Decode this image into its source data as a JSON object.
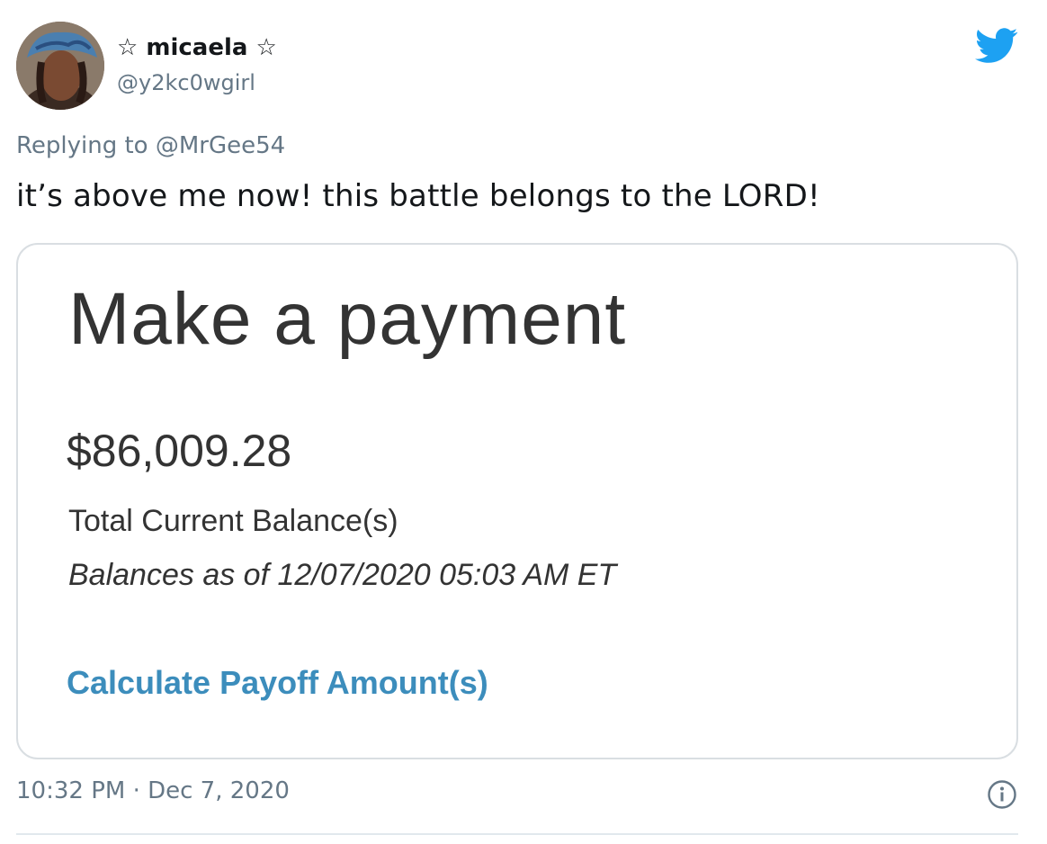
{
  "author": {
    "display_name": "☆ micaela ☆",
    "handle": "@y2kc0wgirl"
  },
  "reply": {
    "prefix": "Replying to",
    "mention": "@MrGee54"
  },
  "tweet": {
    "text": "it’s above me now! this battle belongs to the LORD!",
    "timestamp": "10:32 PM · Dec 7, 2020"
  },
  "card": {
    "title": "Make a payment",
    "amount": "$86,009.28",
    "balance_label": "Total Current Balance(s)",
    "as_of": "Balances as of 12/07/2020 05:03 AM ET",
    "link": "Calculate Payoff Amount(s)"
  },
  "icons": {
    "logo": "twitter-bird-icon",
    "info": "info-icon"
  },
  "colors": {
    "twitter_blue": "#1da1f2",
    "secondary_text": "#657786",
    "link_blue": "#3c8dbc"
  }
}
